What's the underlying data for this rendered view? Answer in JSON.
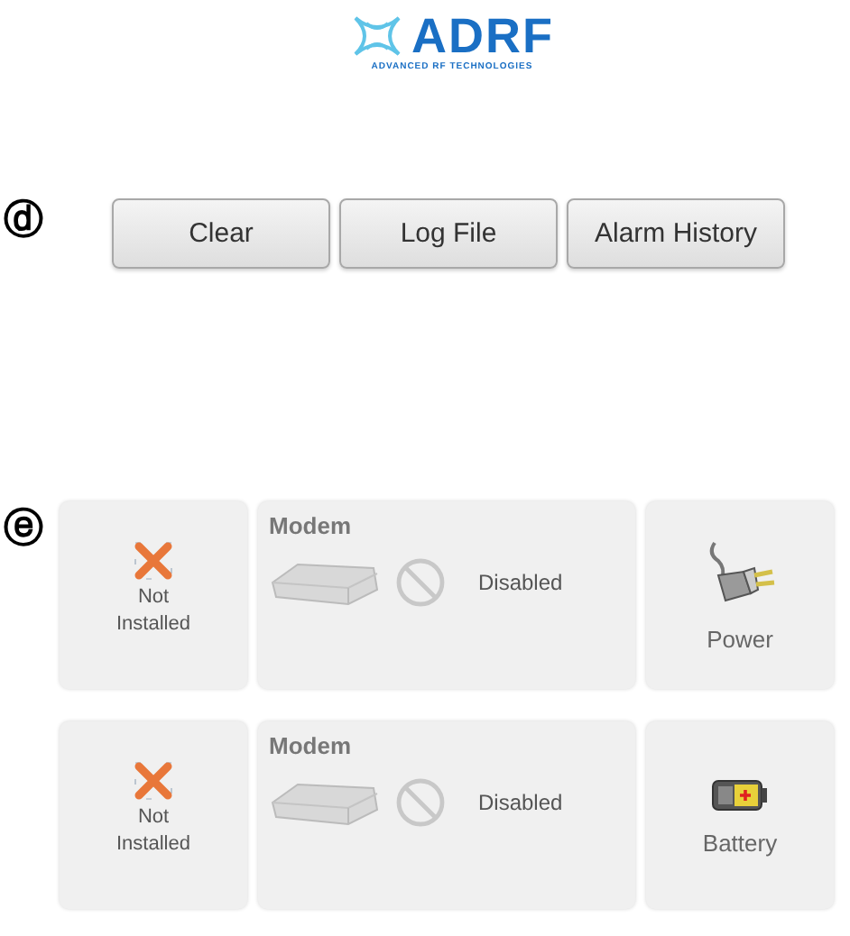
{
  "logo": {
    "name": "ADRF",
    "tagline": "ADVANCED RF TECHNOLOGIES"
  },
  "sections": [
    {
      "marker": "ⓓ",
      "kind": "buttons",
      "buttons": [
        "Clear",
        "Log File",
        "Alarm History"
      ]
    },
    {
      "marker": "ⓔ",
      "kind": "panels",
      "rows": [
        {
          "status": {
            "label": "Not Installed"
          },
          "modem": {
            "title": "Modem",
            "state": "Disabled"
          },
          "supply": {
            "kind": "power",
            "label": "Power"
          }
        },
        {
          "status": {
            "label": "Not Installed"
          },
          "modem": {
            "title": "Modem",
            "state": "Disabled"
          },
          "supply": {
            "kind": "battery",
            "label": "Battery"
          }
        }
      ]
    }
  ]
}
